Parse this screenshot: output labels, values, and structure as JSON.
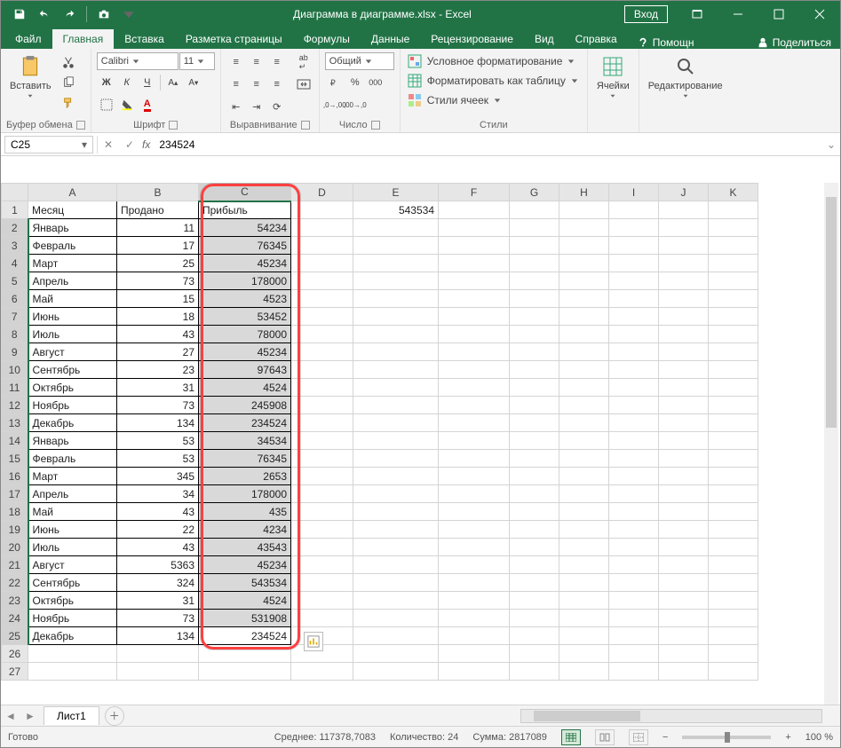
{
  "titlebar": {
    "title": "Диаграмма в диаграмме.xlsx - Excel",
    "login": "Вход"
  },
  "tabs": {
    "file": "Файл",
    "home": "Главная",
    "insert": "Вставка",
    "layout": "Разметка страницы",
    "formulas": "Формулы",
    "data": "Данные",
    "review": "Рецензирование",
    "view": "Вид",
    "help": "Справка",
    "tellme": "Помощн",
    "share": "Поделиться"
  },
  "ribbon": {
    "clipboard": {
      "label": "Буфер обмена",
      "paste": "Вставить"
    },
    "font": {
      "label": "Шрифт",
      "name": "Calibri",
      "size": "11"
    },
    "alignment": {
      "label": "Выравнивание"
    },
    "number": {
      "label": "Число",
      "format": "Общий"
    },
    "styles": {
      "label": "Стили",
      "cond": "Условное форматирование",
      "table": "Форматировать как таблицу",
      "cell": "Стили ячеек"
    },
    "cells": {
      "label": "Ячейки"
    },
    "editing": {
      "label": "Редактирование"
    }
  },
  "formulabar": {
    "namebox": "C25",
    "value": "234524"
  },
  "columns": [
    "A",
    "B",
    "C",
    "D",
    "E",
    "F",
    "G",
    "H",
    "I",
    "J",
    "K"
  ],
  "headers": {
    "A": "Месяц",
    "B": "Продано",
    "C": "Прибыль"
  },
  "extra": {
    "E1": "543534"
  },
  "rows": [
    {
      "n": 1
    },
    {
      "n": 2,
      "a": "Январь",
      "b": "11",
      "c": "54234"
    },
    {
      "n": 3,
      "a": "Февраль",
      "b": "17",
      "c": "76345"
    },
    {
      "n": 4,
      "a": "Март",
      "b": "25",
      "c": "45234"
    },
    {
      "n": 5,
      "a": "Апрель",
      "b": "73",
      "c": "178000"
    },
    {
      "n": 6,
      "a": "Май",
      "b": "15",
      "c": "4523"
    },
    {
      "n": 7,
      "a": "Июнь",
      "b": "18",
      "c": "53452"
    },
    {
      "n": 8,
      "a": "Июль",
      "b": "43",
      "c": "78000"
    },
    {
      "n": 9,
      "a": "Август",
      "b": "27",
      "c": "45234"
    },
    {
      "n": 10,
      "a": "Сентябрь",
      "b": "23",
      "c": "97643"
    },
    {
      "n": 11,
      "a": "Октябрь",
      "b": "31",
      "c": "4524"
    },
    {
      "n": 12,
      "a": "Ноябрь",
      "b": "73",
      "c": "245908"
    },
    {
      "n": 13,
      "a": "Декабрь",
      "b": "134",
      "c": "234524"
    },
    {
      "n": 14,
      "a": "Январь",
      "b": "53",
      "c": "34534"
    },
    {
      "n": 15,
      "a": "Февраль",
      "b": "53",
      "c": "76345"
    },
    {
      "n": 16,
      "a": "Март",
      "b": "345",
      "c": "2653"
    },
    {
      "n": 17,
      "a": "Апрель",
      "b": "34",
      "c": "178000"
    },
    {
      "n": 18,
      "a": "Май",
      "b": "43",
      "c": "435"
    },
    {
      "n": 19,
      "a": "Июнь",
      "b": "22",
      "c": "4234"
    },
    {
      "n": 20,
      "a": "Июль",
      "b": "43",
      "c": "43543"
    },
    {
      "n": 21,
      "a": "Август",
      "b": "5363",
      "c": "45234"
    },
    {
      "n": 22,
      "a": "Сентябрь",
      "b": "324",
      "c": "543534"
    },
    {
      "n": 23,
      "a": "Октябрь",
      "b": "31",
      "c": "4524"
    },
    {
      "n": 24,
      "a": "Ноябрь",
      "b": "73",
      "c": "531908"
    },
    {
      "n": 25,
      "a": "Декабрь",
      "b": "134",
      "c": "234524"
    }
  ],
  "active_row": 25,
  "sheet": {
    "name": "Лист1"
  },
  "status": {
    "ready": "Готово",
    "avg_label": "Среднее:",
    "avg": "117378,7083",
    "count_label": "Количество:",
    "count": "24",
    "sum_label": "Сумма:",
    "sum": "2817089",
    "zoom": "100 %"
  }
}
